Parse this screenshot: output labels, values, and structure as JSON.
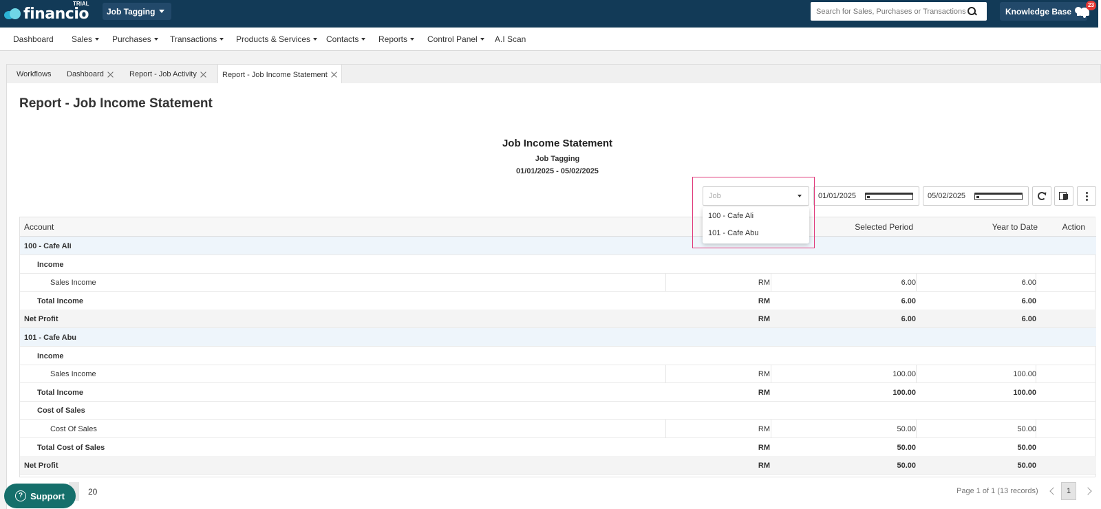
{
  "app": {
    "brand": "financio",
    "trial": "TRIAL",
    "org": "Job Tagging",
    "search_placeholder": "Search for Sales, Purchases or Transactions",
    "knowledge_base": "Knowledge Base",
    "notifications": "23"
  },
  "menu": [
    "Dashboard",
    "Sales",
    "Purchases",
    "Transactions",
    "Products & Services",
    "Contacts",
    "Reports",
    "Control Panel",
    "A.I Scan"
  ],
  "tabs": [
    "Workflows",
    "Dashboard",
    "Report - Job Activity",
    "Report - Job Income Statement"
  ],
  "page_title": "Report - Job Income Statement",
  "report": {
    "title": "Job Income Statement",
    "subtitle": "Job Tagging",
    "range": "01/01/2025 - 05/02/2025"
  },
  "filters": {
    "job_placeholder": "Job",
    "from": "01/01/2025",
    "to": "05/02/2025",
    "job_options": [
      "100 - Cafe Ali",
      "101 - Cafe Abu"
    ]
  },
  "table": {
    "headers": {
      "account": "Account",
      "selected": "Selected Period",
      "ytd": "Year to Date",
      "action": "Action"
    },
    "rows": [
      {
        "type": "job",
        "label": "100 - Cafe Ali"
      },
      {
        "type": "group",
        "label": "Income"
      },
      {
        "type": "item",
        "label": "Sales Income",
        "cur": "RM",
        "sel": "6.00",
        "ytd": "6.00"
      },
      {
        "type": "total",
        "label": "Total Income",
        "cur": "RM",
        "sel": "6.00",
        "ytd": "6.00"
      },
      {
        "type": "net",
        "label": "Net Profit",
        "cur": "RM",
        "sel": "6.00",
        "ytd": "6.00"
      },
      {
        "type": "job",
        "label": "101 - Cafe Abu"
      },
      {
        "type": "group",
        "label": "Income"
      },
      {
        "type": "item",
        "label": "Sales Income",
        "cur": "RM",
        "sel": "100.00",
        "ytd": "100.00"
      },
      {
        "type": "total",
        "label": "Total Income",
        "cur": "RM",
        "sel": "100.00",
        "ytd": "100.00"
      },
      {
        "type": "group",
        "label": "Cost of Sales"
      },
      {
        "type": "item",
        "label": "Cost Of Sales",
        "cur": "RM",
        "sel": "50.00",
        "ytd": "50.00"
      },
      {
        "type": "total",
        "label": "Total Cost of Sales",
        "cur": "RM",
        "sel": "50.00",
        "ytd": "50.00"
      },
      {
        "type": "net",
        "label": "Net Profit",
        "cur": "RM",
        "sel": "50.00",
        "ytd": "50.00"
      }
    ]
  },
  "footer": {
    "support": "Support",
    "page_size": "20",
    "pager_text": "Page 1 of 1 (13 records)",
    "page": "1"
  }
}
